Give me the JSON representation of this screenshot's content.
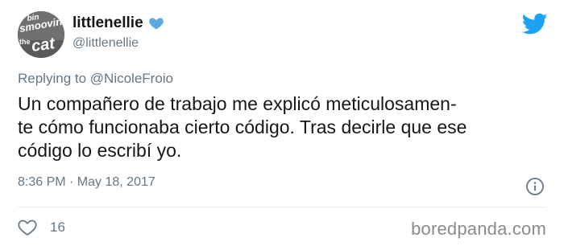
{
  "user": {
    "display_name": "littlenellie",
    "handle": "@littlenellie",
    "avatar_lines": [
      "bin",
      "smoovin",
      "the",
      "cat"
    ]
  },
  "reply": {
    "prefix": "Replying to ",
    "mention": "@NicoleFroio"
  },
  "tweet": {
    "lines": [
      "Un compañero de trabajo me explicó meticulosamen-",
      "te cómo funcionaba cierto código. Tras decirle que ese",
      "código lo escribí yo."
    ]
  },
  "meta": {
    "timestamp": "8:36 PM · May 18, 2017",
    "likes": "16"
  },
  "watermark": "boredpanda.com",
  "icons": {
    "heart": "blue-heart-icon",
    "bird": "twitter-bird-icon",
    "info": "info-icon",
    "like": "like-heart-icon"
  },
  "colors": {
    "text": "#14171a",
    "muted": "#657786",
    "twitter_blue": "#1da1f2",
    "heart_blue": "#5ea9dd"
  }
}
